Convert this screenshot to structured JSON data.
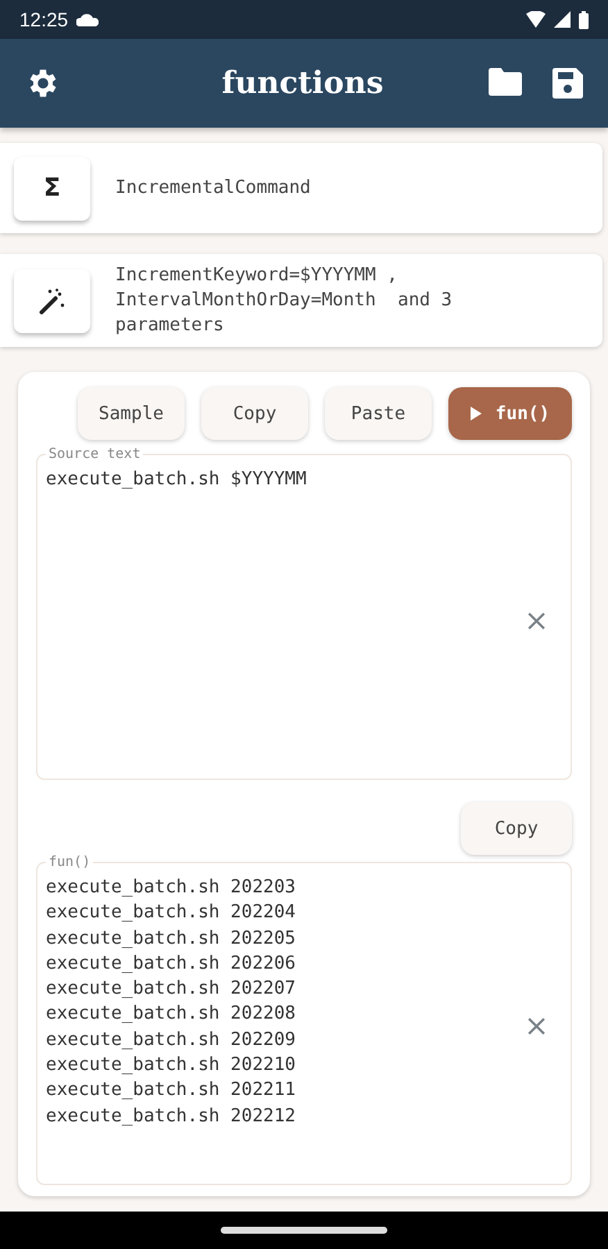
{
  "status_bar": {
    "time": "12:25"
  },
  "app_bar": {
    "title": "functions"
  },
  "function_card": {
    "icon": "Σ",
    "name": "IncrementalCommand"
  },
  "parameters_card": {
    "summary": "IncrementKeyword=$YYYYMM ,\nIntervalMonthOrDay=Month  and 3\nparameters"
  },
  "toolbar": [
    {
      "label": "Sample",
      "kind": "plain"
    },
    {
      "label": "Copy",
      "kind": "plain"
    },
    {
      "label": "Paste",
      "kind": "plain"
    },
    {
      "label": "fun()",
      "kind": "run"
    }
  ],
  "source_field": {
    "label": "Source text",
    "value": "execute_batch.sh $YYYYMM"
  },
  "output_copy": {
    "label": "Copy"
  },
  "output_field": {
    "label": "fun()",
    "lines": [
      "execute_batch.sh 202203",
      "execute_batch.sh 202204",
      "execute_batch.sh 202205",
      "execute_batch.sh 202206",
      "execute_batch.sh 202207",
      "execute_batch.sh 202208",
      "execute_batch.sh 202209",
      "execute_batch.sh 202210",
      "execute_batch.sh 202211",
      "execute_batch.sh 202212"
    ]
  }
}
